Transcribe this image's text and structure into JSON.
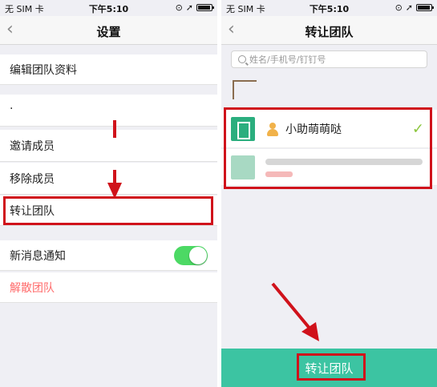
{
  "status_bar": {
    "carrier": "无 SIM 卡",
    "time": "下午5:10"
  },
  "settings_screen": {
    "title": "设置",
    "back": "‹",
    "edit_profile": "编辑团队资料",
    "dot": "·",
    "invite": "邀请成员",
    "remove": "移除成员",
    "transfer": "转让团队",
    "notify": "新消息通知",
    "notify_on": true,
    "dissolve": "解散团队"
  },
  "transfer_screen": {
    "title": "转让团队",
    "back": "‹",
    "search_placeholder": "姓名/手机号/钉钉号",
    "members": [
      {
        "name": "小助萌萌哒",
        "selected": true
      }
    ],
    "check": "✓",
    "button": "转让团队"
  },
  "colors": {
    "annotation_red": "#d0121b",
    "toggle_on": "#4cd964",
    "accent": "#3cc4a2",
    "danger_text": "#ff6b6b"
  }
}
